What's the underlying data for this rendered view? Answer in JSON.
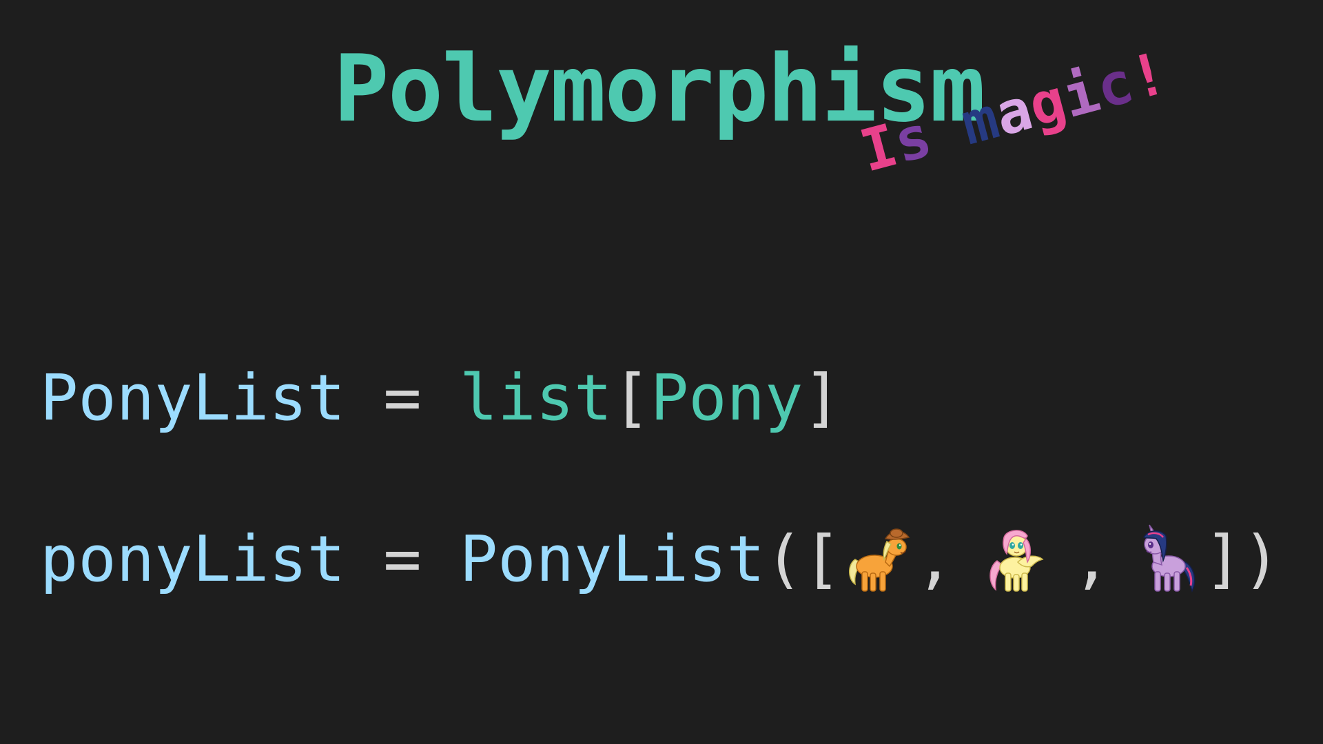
{
  "slide": {
    "title": "Polymorphism",
    "subtitle_letters": [
      {
        "ch": "I",
        "color": "#e8418b"
      },
      {
        "ch": "s",
        "color": "#7a3fa2"
      },
      {
        "ch": " ",
        "color": "#000000"
      },
      {
        "ch": "m",
        "color": "#263a82"
      },
      {
        "ch": "a",
        "color": "#d9a6e6"
      },
      {
        "ch": "g",
        "color": "#e8418b"
      },
      {
        "ch": "i",
        "color": "#b06ac0"
      },
      {
        "ch": "c",
        "color": "#6a2f8a"
      },
      {
        "ch": "!",
        "color": "#e8418b"
      }
    ],
    "code": {
      "line1": {
        "name": "PonyList",
        "eq": "=",
        "fn": "list",
        "open_bracket": "[",
        "type": "Pony",
        "close_bracket": "]"
      },
      "line2": {
        "name": "ponyList",
        "eq": "=",
        "ctor": "PonyList",
        "open": "([",
        "sep1": ",",
        "sep2": ",",
        "close": "])",
        "ponies": [
          "applejack-pony-icon",
          "fluttershy-pony-icon",
          "twilight-sparkle-pony-icon"
        ]
      }
    },
    "colors": {
      "background": "#1e1e1e",
      "title": "#4ec9b0",
      "identifier": "#9cdcfe",
      "type": "#4ec9b0",
      "punctuation": "#d4d4d4"
    }
  }
}
